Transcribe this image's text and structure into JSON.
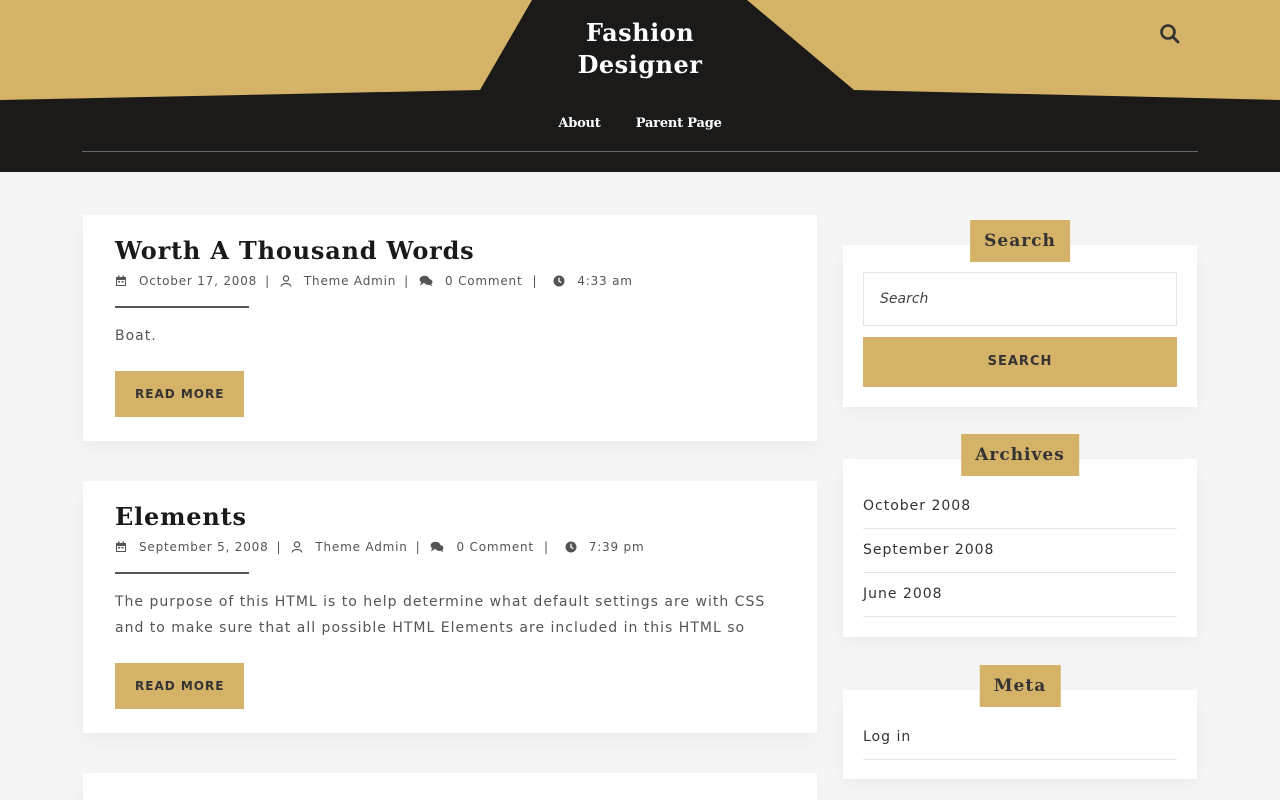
{
  "site": {
    "title_line1": "Fashion",
    "title_line2": "Designer"
  },
  "nav": {
    "items": [
      "About",
      "Parent Page"
    ]
  },
  "colors": {
    "accent": "#d4b267",
    "dark": "#1b1a18",
    "background": "#f5f5f5"
  },
  "posts": [
    {
      "title": "Worth A Thousand Words",
      "date": "October 17, 2008",
      "author": "Theme Admin",
      "comments": "0 Comment",
      "time": "4:33 am",
      "excerpt": "Boat.",
      "button": "READ MORE"
    },
    {
      "title": "Elements",
      "date": "September 5, 2008",
      "author": "Theme Admin",
      "comments": "0 Comment",
      "time": "7:39 pm",
      "excerpt": "The purpose of this HTML is to help determine what default settings are with CSS and to make sure that all possible HTML Elements are included in this HTML so",
      "button": "READ MORE"
    }
  ],
  "sidebar": {
    "search": {
      "title": "Search",
      "placeholder": "Search",
      "button": "SEARCH"
    },
    "archives": {
      "title": "Archives",
      "items": [
        "October 2008",
        "September 2008",
        "June 2008"
      ]
    },
    "meta": {
      "title": "Meta",
      "items": [
        "Log in"
      ]
    }
  },
  "icons": [
    "search-icon",
    "calendar-icon",
    "user-icon",
    "comments-icon",
    "clock-icon"
  ]
}
